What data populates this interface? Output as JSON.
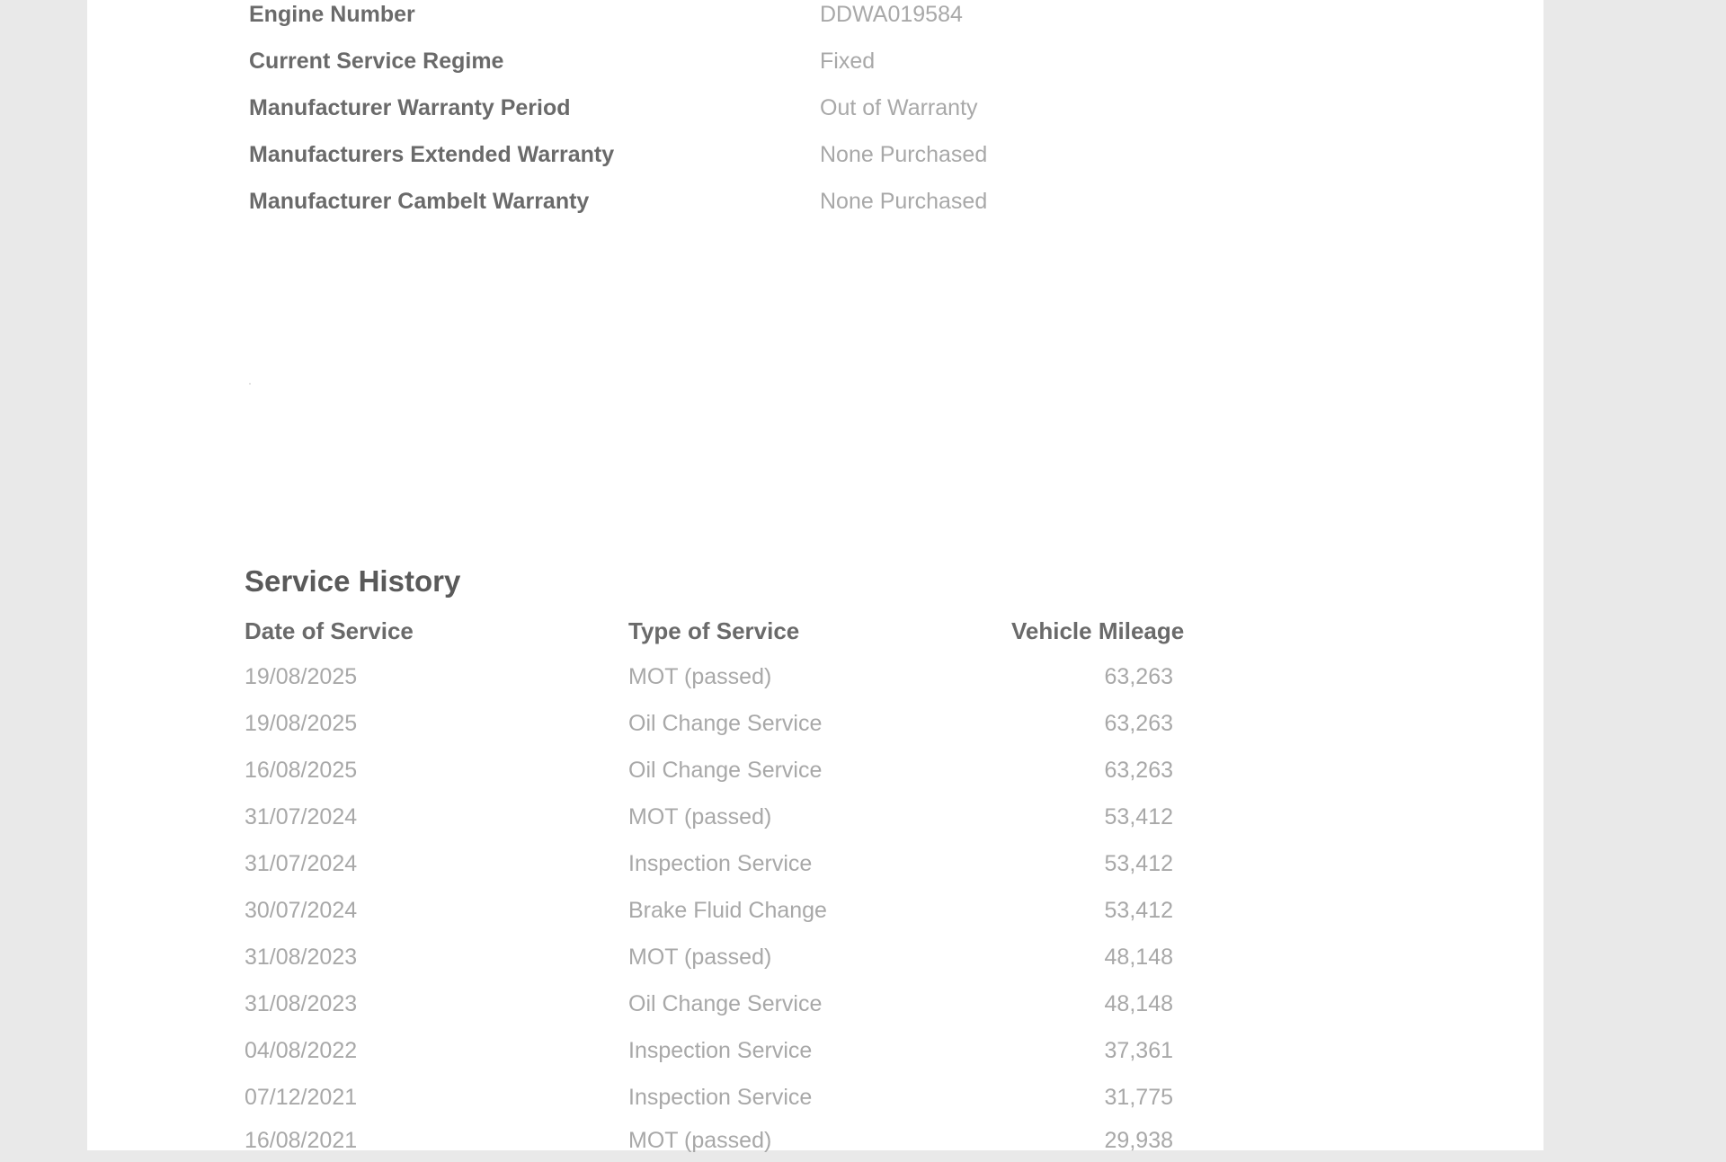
{
  "vehicle_details": [
    {
      "label": "Engine Number",
      "value": "DDWA019584"
    },
    {
      "label": "Current Service Regime",
      "value": "Fixed"
    },
    {
      "label": "Manufacturer Warranty Period",
      "value": "Out of Warranty"
    },
    {
      "label": "Manufacturers Extended Warranty",
      "value": "None Purchased"
    },
    {
      "label": "Manufacturer Cambelt Warranty",
      "value": "None Purchased"
    }
  ],
  "service_history": {
    "title": "Service History",
    "columns": {
      "date": "Date of Service",
      "type": "Type of Service",
      "mileage": "Vehicle Mileage"
    },
    "rows": [
      {
        "date": "19/08/2025",
        "type": "MOT (passed)",
        "mileage": "63,263"
      },
      {
        "date": "19/08/2025",
        "type": "Oil Change Service",
        "mileage": "63,263"
      },
      {
        "date": "16/08/2025",
        "type": "Oil Change Service",
        "mileage": "63,263"
      },
      {
        "date": "31/07/2024",
        "type": "MOT (passed)",
        "mileage": "53,412"
      },
      {
        "date": "31/07/2024",
        "type": "Inspection Service",
        "mileage": "53,412"
      },
      {
        "date": "30/07/2024",
        "type": "Brake Fluid Change",
        "mileage": "53,412"
      },
      {
        "date": "31/08/2023",
        "type": "MOT (passed)",
        "mileage": "48,148"
      },
      {
        "date": "31/08/2023",
        "type": "Oil Change Service",
        "mileage": "48,148"
      },
      {
        "date": "04/08/2022",
        "type": "Inspection Service",
        "mileage": "37,361"
      },
      {
        "date": "07/12/2021",
        "type": "Inspection Service",
        "mileage": "31,775"
      },
      {
        "date": "16/08/2021",
        "type": "MOT (passed)",
        "mileage": "29,938"
      }
    ]
  }
}
